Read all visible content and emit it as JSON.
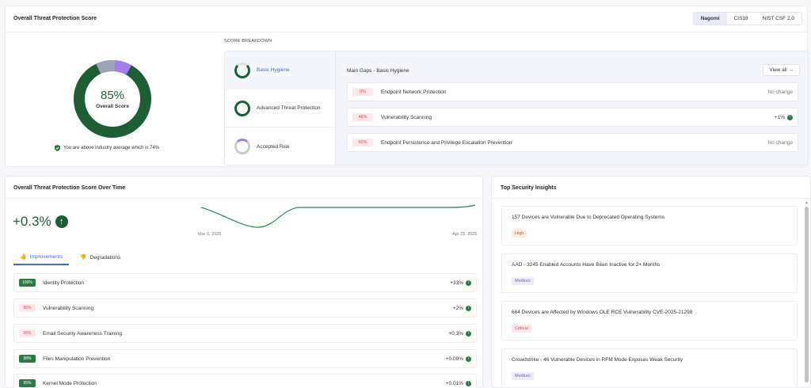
{
  "score": {
    "title": "Overall Threat Protection Score",
    "frameworks": [
      "Nagomi",
      "CIS18",
      "NIST CSF 2.0"
    ],
    "active_framework": "Nagomi",
    "percent": "85%",
    "percent_value": 85,
    "label": "Overall Score",
    "industry_note": "You are above industry average which is 74%"
  },
  "breakdown": {
    "label": "SCORE BREAKDOWN",
    "items": [
      {
        "label": "Basic Hygiene",
        "active": true
      },
      {
        "label": "Advanced Threat Protection",
        "active": false
      },
      {
        "label": "Accepted Risk",
        "active": false
      }
    ],
    "gaps_title": "Main Gaps - Basic Hygiene",
    "view_all": "View all →",
    "gaps": [
      {
        "badge": "0%",
        "name": "Endpoint Network Protection",
        "change": "No change"
      },
      {
        "badge": "48%",
        "name": "Vulnerability Scanning",
        "change": "+1%"
      },
      {
        "badge": "60%",
        "name": "Endpoint Persistence and Privilege Escalation Prevention",
        "change": "No change"
      }
    ]
  },
  "over_time": {
    "title": "Overall Threat Protection Score Over Time",
    "delta": "+0.3%",
    "start_date": "Mar 6, 2025",
    "end_date": "Apr 22, 2025",
    "tabs": [
      "Improvements",
      "Degradations"
    ],
    "rows": [
      {
        "badge": "100%",
        "name": "Identity Protection",
        "change": "+33%"
      },
      {
        "badge": "85%",
        "name": "Vulnerability Scanning",
        "change": "+2%"
      },
      {
        "badge": "66%",
        "name": "Email Security Awareness Training",
        "change": "+0.3%"
      },
      {
        "badge": "98%",
        "name": "Files Manipulation Prevention",
        "change": "+0.09%"
      },
      {
        "badge": "95%",
        "name": "Kernel Mode Protection",
        "change": "+0.01%"
      }
    ]
  },
  "insights": {
    "title": "Top Security Insights",
    "items": [
      {
        "title": "157 Devices are Vulnerable Due to Deprecated Operating Systems",
        "severity": "High"
      },
      {
        "title": "AAD - 3245 Enabled Accounts Have Been Inactive for 2+ Months",
        "severity": "Medium"
      },
      {
        "title": "664 Devices are Affected by Windows OLE RCE Vulnerability CVE-2025-21298",
        "severity": "Critical"
      },
      {
        "title": "Crowdstrike - 46 Vulnerable Devices in RFM Mode Exposes Weak Security",
        "severity": "Medium"
      }
    ]
  },
  "colors": {
    "primary_green": "#1e5e34",
    "accent_blue": "#3b6fd6",
    "purple": "#a37cf0"
  }
}
